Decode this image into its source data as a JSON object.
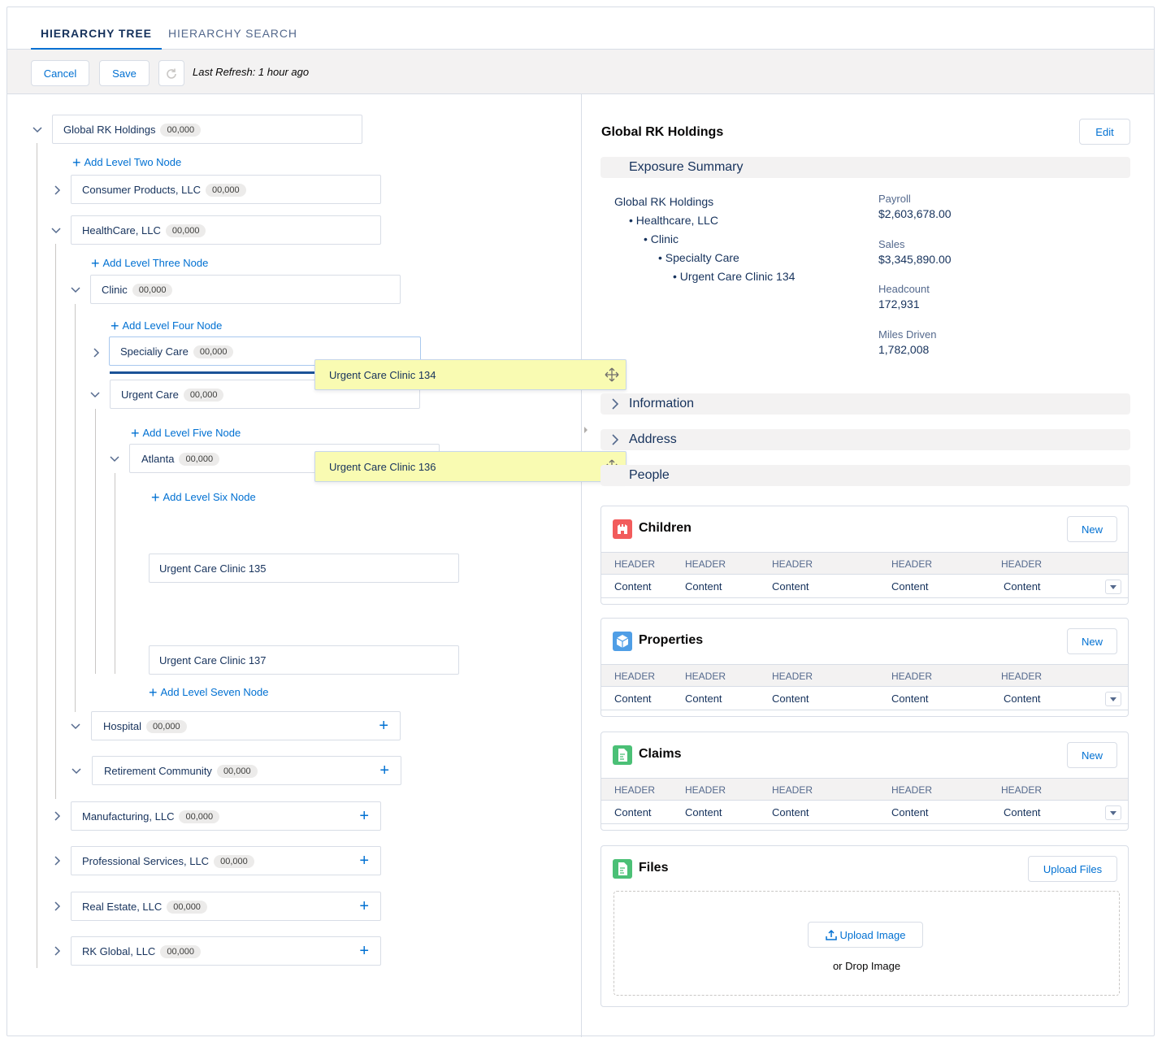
{
  "tabs": [
    {
      "label": "HIERARCHY TREE",
      "active": true
    },
    {
      "label": "HIERARCHY SEARCH",
      "active": false
    }
  ],
  "toolbar": {
    "cancel": "Cancel",
    "save": "Save",
    "refresh_icon": "refresh-icon",
    "last_refresh": "Last Refresh: 1 hour ago"
  },
  "tree": {
    "root": {
      "label": "Global RK Holdings",
      "count": "00,000"
    },
    "add_level_two": "Add Level Two Node",
    "consumer": {
      "label": "Consumer Products, LLC",
      "count": "00,000"
    },
    "healthcare": {
      "label": "HealthCare, LLC",
      "count": "00,000"
    },
    "add_level_three": "Add Level Three Node",
    "clinic": {
      "label": "Clinic",
      "count": "00,000"
    },
    "add_level_four": "Add Level Four Node",
    "specialty": {
      "label": "Specialiy Care",
      "count": "00,000"
    },
    "urgent": {
      "label": "Urgent Care",
      "count": "00,000"
    },
    "add_level_five": "Add Level Five Node",
    "atlanta": {
      "label": "Atlanta",
      "count": "00,000"
    },
    "add_level_six": "Add Level Six Node",
    "clinic135": "Urgent Care Clinic 135",
    "clinic137": "Urgent Care Clinic 137",
    "add_level_seven": "Add Level Seven Node",
    "hospital": {
      "label": "Hospital",
      "count": "00,000"
    },
    "retirement": {
      "label": "Retirement Community",
      "count": "00,000"
    },
    "manufacturing": {
      "label": "Manufacturing, LLC",
      "count": "00,000"
    },
    "professional": {
      "label": "Professional Services, LLC",
      "count": "00,000"
    },
    "realestate": {
      "label": "Real Estate, LLC",
      "count": "00,000"
    },
    "rkglobal": {
      "label": "RK Global, LLC",
      "count": "00,000"
    },
    "dragging": [
      "Urgent Care Clinic 134",
      "Urgent Care Clinic 136"
    ]
  },
  "detail": {
    "title": "Global RK Holdings",
    "edit": "Edit",
    "exposure_summary": "Exposure Summary",
    "path": [
      "Global RK Holdings",
      "• Healthcare, LLC",
      "• Clinic",
      "• Specialty Care",
      "• Urgent Care Clinic 134"
    ],
    "metrics": [
      {
        "label": "Payroll",
        "value": "$2,603,678.00"
      },
      {
        "label": "Sales",
        "value": "$3,345,890.00"
      },
      {
        "label": "Headcount",
        "value": "172,931"
      },
      {
        "label": "Miles Driven",
        "value": "1,782,008"
      }
    ],
    "sections": [
      "Information",
      "Address",
      "People"
    ]
  },
  "cards": [
    {
      "title": "Children",
      "button": "New",
      "icon": "children-icon",
      "color": "#f25c5c",
      "headers": [
        "HEADER",
        "HEADER",
        "HEADER",
        "HEADER",
        "HEADER"
      ],
      "row": [
        "Content",
        "Content",
        "Content",
        "Content",
        "Content"
      ]
    },
    {
      "title": "Properties",
      "button": "New",
      "icon": "properties-icon",
      "color": "#4f9ee6",
      "headers": [
        "HEADER",
        "HEADER",
        "HEADER",
        "HEADER",
        "HEADER"
      ],
      "row": [
        "Content",
        "Content",
        "Content",
        "Content",
        "Content"
      ]
    },
    {
      "title": "Claims",
      "button": "New",
      "icon": "claims-icon",
      "color": "#4bc076",
      "headers": [
        "HEADER",
        "HEADER",
        "HEADER",
        "HEADER",
        "HEADER"
      ],
      "row": [
        "Content",
        "Content",
        "Content",
        "Content",
        "Content"
      ]
    }
  ],
  "files": {
    "title": "Files",
    "icon": "files-icon",
    "upload_files": "Upload Files",
    "upload_image": "Upload Image",
    "or_drop": "or Drop Image"
  }
}
